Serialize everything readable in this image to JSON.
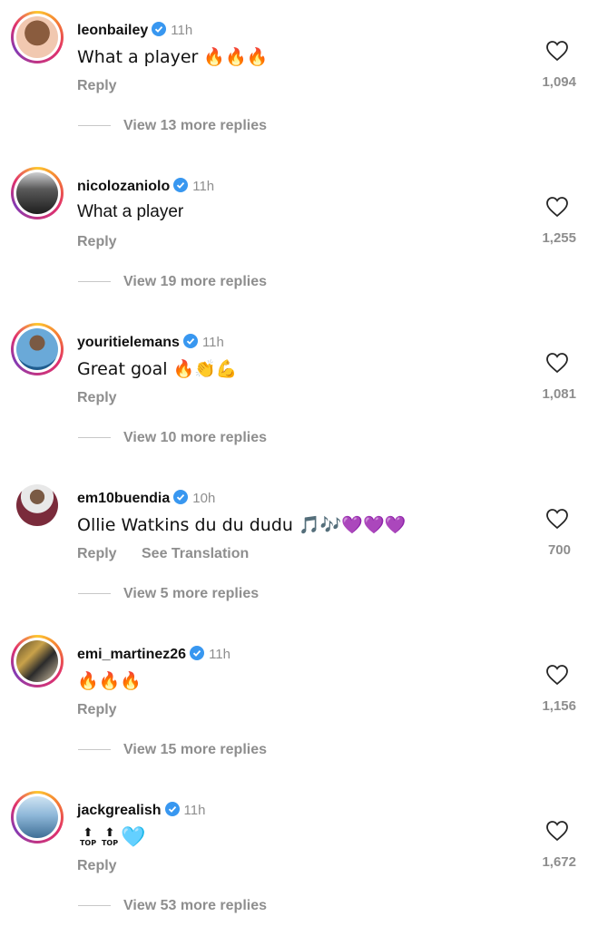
{
  "comments": [
    {
      "username": "leonbailey",
      "time": "11h",
      "text": "What a player 🔥🔥🔥",
      "reply": "Reply",
      "likes": "1,094",
      "more": "View 13 more replies",
      "ring": true,
      "avatar_color": "#6b4a34"
    },
    {
      "username": "nicolozaniolo",
      "time": "11h",
      "text": "What a player",
      "reply": "Reply",
      "likes": "1,255",
      "more": "View 19 more replies",
      "ring": true,
      "avatar_color": "#3a3a3a"
    },
    {
      "username": "youritielemans",
      "time": "11h",
      "text": "Great goal 🔥👏💪",
      "reply": "Reply",
      "likes": "1,081",
      "more": "View 10 more replies",
      "ring": true,
      "avatar_color": "#6aa9d8"
    },
    {
      "username": "em10buendia",
      "time": "10h",
      "text": "Ollie Watkins du du dudu 🎵🎶💜💜💜",
      "reply": "Reply",
      "translate": "See Translation",
      "likes": "700",
      "more": "View 5 more replies",
      "ring": false,
      "avatar_color": "#7a2b3b"
    },
    {
      "username": "emi_martinez26",
      "time": "11h",
      "text": "🔥🔥🔥",
      "reply": "Reply",
      "likes": "1,156",
      "more": "View 15 more replies",
      "ring": true,
      "avatar_color": "#b08b3a"
    },
    {
      "username": "jackgrealish",
      "time": "11h",
      "text_badge": "TOP",
      "text_tail": "🩵",
      "reply": "Reply",
      "likes": "1,672",
      "more": "View 53 more replies",
      "ring": true,
      "avatar_color": "#8fb8d9"
    }
  ],
  "colors": {
    "verified": "#3897f0",
    "muted": "#8e8e8e"
  },
  "icons": {
    "verified": "verified-badge-icon",
    "like": "heart-outline-icon"
  }
}
